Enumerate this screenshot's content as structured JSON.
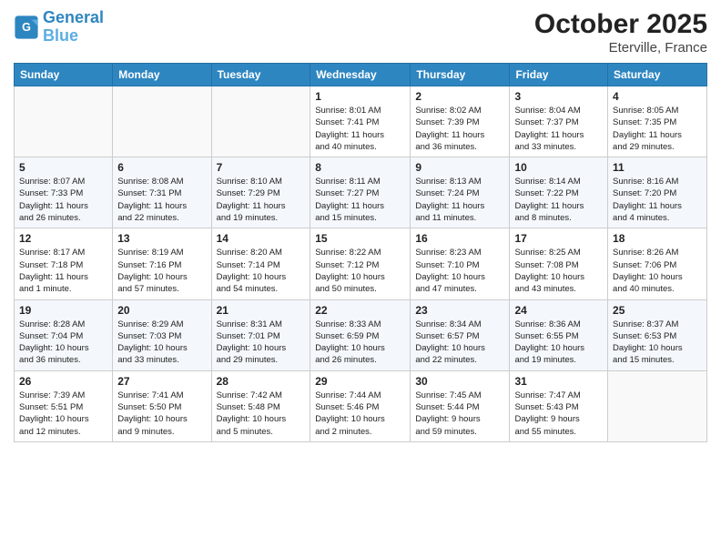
{
  "header": {
    "logo_line1": "General",
    "logo_line2": "Blue",
    "month": "October 2025",
    "location": "Eterville, France"
  },
  "weekdays": [
    "Sunday",
    "Monday",
    "Tuesday",
    "Wednesday",
    "Thursday",
    "Friday",
    "Saturday"
  ],
  "weeks": [
    [
      {
        "day": "",
        "info": ""
      },
      {
        "day": "",
        "info": ""
      },
      {
        "day": "",
        "info": ""
      },
      {
        "day": "1",
        "info": "Sunrise: 8:01 AM\nSunset: 7:41 PM\nDaylight: 11 hours\nand 40 minutes."
      },
      {
        "day": "2",
        "info": "Sunrise: 8:02 AM\nSunset: 7:39 PM\nDaylight: 11 hours\nand 36 minutes."
      },
      {
        "day": "3",
        "info": "Sunrise: 8:04 AM\nSunset: 7:37 PM\nDaylight: 11 hours\nand 33 minutes."
      },
      {
        "day": "4",
        "info": "Sunrise: 8:05 AM\nSunset: 7:35 PM\nDaylight: 11 hours\nand 29 minutes."
      }
    ],
    [
      {
        "day": "5",
        "info": "Sunrise: 8:07 AM\nSunset: 7:33 PM\nDaylight: 11 hours\nand 26 minutes."
      },
      {
        "day": "6",
        "info": "Sunrise: 8:08 AM\nSunset: 7:31 PM\nDaylight: 11 hours\nand 22 minutes."
      },
      {
        "day": "7",
        "info": "Sunrise: 8:10 AM\nSunset: 7:29 PM\nDaylight: 11 hours\nand 19 minutes."
      },
      {
        "day": "8",
        "info": "Sunrise: 8:11 AM\nSunset: 7:27 PM\nDaylight: 11 hours\nand 15 minutes."
      },
      {
        "day": "9",
        "info": "Sunrise: 8:13 AM\nSunset: 7:24 PM\nDaylight: 11 hours\nand 11 minutes."
      },
      {
        "day": "10",
        "info": "Sunrise: 8:14 AM\nSunset: 7:22 PM\nDaylight: 11 hours\nand 8 minutes."
      },
      {
        "day": "11",
        "info": "Sunrise: 8:16 AM\nSunset: 7:20 PM\nDaylight: 11 hours\nand 4 minutes."
      }
    ],
    [
      {
        "day": "12",
        "info": "Sunrise: 8:17 AM\nSunset: 7:18 PM\nDaylight: 11 hours\nand 1 minute."
      },
      {
        "day": "13",
        "info": "Sunrise: 8:19 AM\nSunset: 7:16 PM\nDaylight: 10 hours\nand 57 minutes."
      },
      {
        "day": "14",
        "info": "Sunrise: 8:20 AM\nSunset: 7:14 PM\nDaylight: 10 hours\nand 54 minutes."
      },
      {
        "day": "15",
        "info": "Sunrise: 8:22 AM\nSunset: 7:12 PM\nDaylight: 10 hours\nand 50 minutes."
      },
      {
        "day": "16",
        "info": "Sunrise: 8:23 AM\nSunset: 7:10 PM\nDaylight: 10 hours\nand 47 minutes."
      },
      {
        "day": "17",
        "info": "Sunrise: 8:25 AM\nSunset: 7:08 PM\nDaylight: 10 hours\nand 43 minutes."
      },
      {
        "day": "18",
        "info": "Sunrise: 8:26 AM\nSunset: 7:06 PM\nDaylight: 10 hours\nand 40 minutes."
      }
    ],
    [
      {
        "day": "19",
        "info": "Sunrise: 8:28 AM\nSunset: 7:04 PM\nDaylight: 10 hours\nand 36 minutes."
      },
      {
        "day": "20",
        "info": "Sunrise: 8:29 AM\nSunset: 7:03 PM\nDaylight: 10 hours\nand 33 minutes."
      },
      {
        "day": "21",
        "info": "Sunrise: 8:31 AM\nSunset: 7:01 PM\nDaylight: 10 hours\nand 29 minutes."
      },
      {
        "day": "22",
        "info": "Sunrise: 8:33 AM\nSunset: 6:59 PM\nDaylight: 10 hours\nand 26 minutes."
      },
      {
        "day": "23",
        "info": "Sunrise: 8:34 AM\nSunset: 6:57 PM\nDaylight: 10 hours\nand 22 minutes."
      },
      {
        "day": "24",
        "info": "Sunrise: 8:36 AM\nSunset: 6:55 PM\nDaylight: 10 hours\nand 19 minutes."
      },
      {
        "day": "25",
        "info": "Sunrise: 8:37 AM\nSunset: 6:53 PM\nDaylight: 10 hours\nand 15 minutes."
      }
    ],
    [
      {
        "day": "26",
        "info": "Sunrise: 7:39 AM\nSunset: 5:51 PM\nDaylight: 10 hours\nand 12 minutes."
      },
      {
        "day": "27",
        "info": "Sunrise: 7:41 AM\nSunset: 5:50 PM\nDaylight: 10 hours\nand 9 minutes."
      },
      {
        "day": "28",
        "info": "Sunrise: 7:42 AM\nSunset: 5:48 PM\nDaylight: 10 hours\nand 5 minutes."
      },
      {
        "day": "29",
        "info": "Sunrise: 7:44 AM\nSunset: 5:46 PM\nDaylight: 10 hours\nand 2 minutes."
      },
      {
        "day": "30",
        "info": "Sunrise: 7:45 AM\nSunset: 5:44 PM\nDaylight: 9 hours\nand 59 minutes."
      },
      {
        "day": "31",
        "info": "Sunrise: 7:47 AM\nSunset: 5:43 PM\nDaylight: 9 hours\nand 55 minutes."
      },
      {
        "day": "",
        "info": ""
      }
    ]
  ]
}
